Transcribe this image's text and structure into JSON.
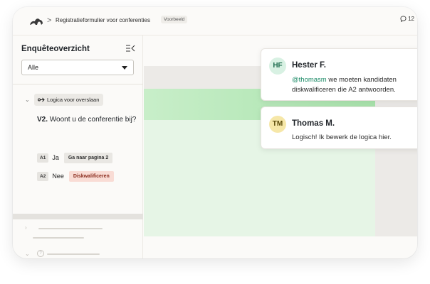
{
  "breadcrumb": {
    "separator": ">",
    "title": "Registratieformulier voor conferenties",
    "badge": "Voorbeeld"
  },
  "comments_count": "12",
  "sidebar": {
    "title": "Enquêteoverzicht",
    "filter": {
      "value": "Alle"
    },
    "logic_tag": "Logica voor overslaan",
    "question": {
      "number": "V2.",
      "text": "Woont u de conferentie bij?"
    },
    "answers": [
      {
        "tag": "A1",
        "text": "Ja",
        "action": "Ga naar pagina 2"
      },
      {
        "tag": "A2",
        "text": "Nee",
        "action": "Diskwalificeren"
      }
    ]
  },
  "comments": [
    {
      "initials": "HF",
      "name": "Hester F.",
      "mention": "@thomasm",
      "text": " we moeten kandidaten diskwalificeren die A2 antwoorden.",
      "avatar_color": "#d8f1e3",
      "avatar_text_color": "#1b6b4c"
    },
    {
      "initials": "TM",
      "name": "Thomas M.",
      "mention": "",
      "text": "Logisch! Ik bewerk de logica hier.",
      "avatar_color": "#f6e7a8",
      "avatar_text_color": "#5a4a0a"
    }
  ],
  "colors": {
    "accent_green": "#a9e3ac",
    "disqualify_bg": "#f9dcd5",
    "mention": "#1b8a66"
  }
}
